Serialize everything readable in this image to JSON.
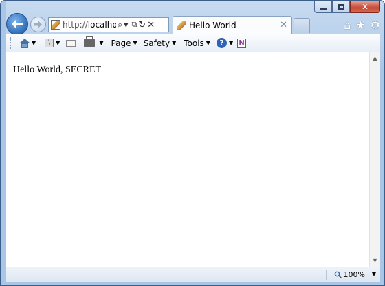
{
  "browser": {
    "address": {
      "url_prefix": "http://",
      "url_host": "localhost:"
    },
    "tab": {
      "title": "Hello World"
    },
    "caption": {
      "minimize": "─",
      "restore": "❐",
      "close": "✕"
    },
    "toolbar_icons": {
      "home": "⌂",
      "favorites": "★",
      "tools": "⚙"
    }
  },
  "command_bar": {
    "page": "Page",
    "safety": "Safety",
    "tools": "Tools",
    "help": "?",
    "onenote": "N"
  },
  "page": {
    "text": "Hello World, SECRET"
  },
  "status_bar": {
    "zoom": "100%"
  },
  "colors": {
    "frame": "#aac6e6",
    "close": "#c74a36",
    "back": "#2e6db8"
  }
}
